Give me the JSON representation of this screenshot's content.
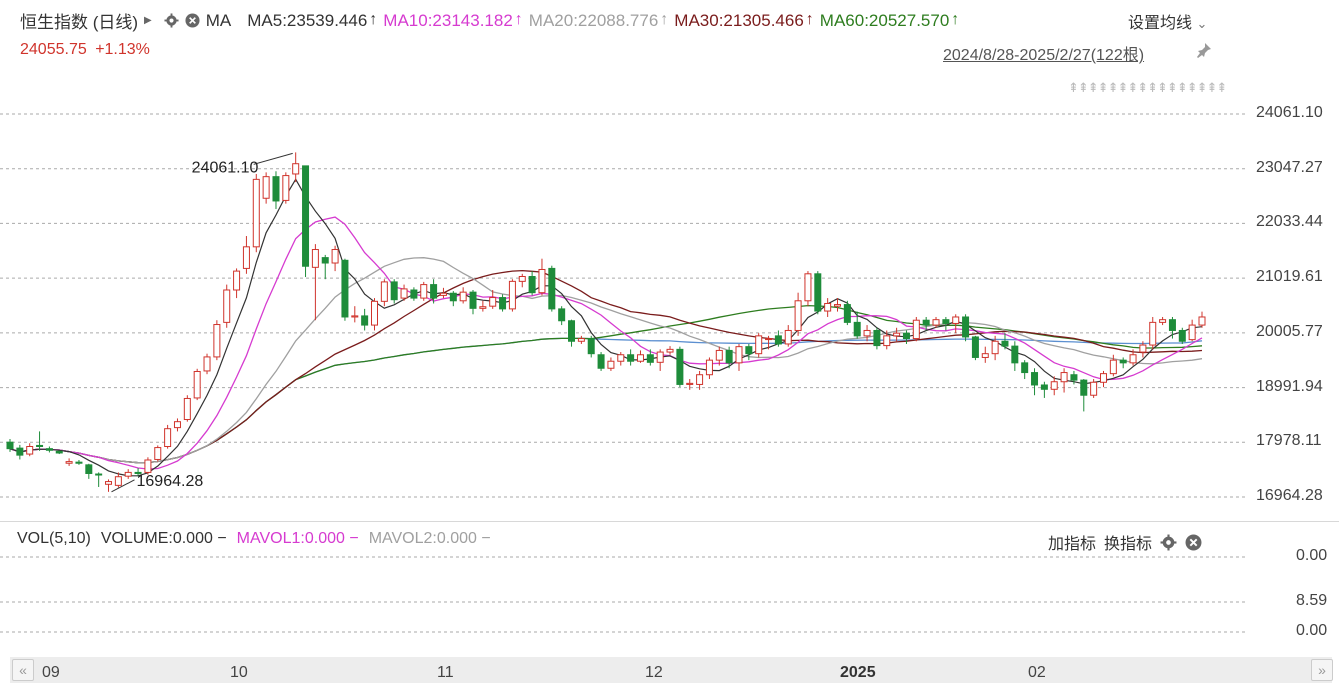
{
  "header": {
    "title": "恒生指数 (日线)",
    "ma_label": "MA",
    "ma_values": [
      {
        "label": "MA5:23539.446",
        "color": "#333333"
      },
      {
        "label": "MA10:23143.182",
        "color": "#d63bd0"
      },
      {
        "label": "MA20:22088.776",
        "color": "#a0a0a0"
      },
      {
        "label": "MA30:21305.466",
        "color": "#7a1c1c"
      },
      {
        "label": "MA60:20527.570",
        "color": "#2e7d1f"
      }
    ],
    "arrow": "↑",
    "settings_label": "设置均线",
    "settings_chevron": "⌄"
  },
  "price": {
    "value": "24055.75",
    "change": "+1.13%"
  },
  "range_label": "2024/8/28-2025/2/27(122根)",
  "pin_icon": "pin-icon",
  "marker_arrows": "⇞⇞⇞⇞⇞⇞⇞⇞⇞⇞⇞⇞⇞⇞⇞⇞",
  "y_ticks": [
    "24061.10",
    "23047.27",
    "22033.44",
    "21019.61",
    "20005.77",
    "18991.94",
    "17978.11",
    "16964.28"
  ],
  "annotations": {
    "high": "24061.10",
    "low": "16964.28"
  },
  "volume": {
    "label": "VOL(5,10)",
    "volume": "VOLUME:0.000",
    "mavol1": "MAVOL1:0.000",
    "mavol2": "MAVOL2:0.000",
    "dash": "−",
    "add_indicator": "加指标",
    "switch_indicator": "换指标",
    "y_ticks": [
      "0.00",
      "8.59",
      "0.00"
    ]
  },
  "x_labels": [
    "09",
    "10",
    "11",
    "12",
    "2025",
    "02"
  ],
  "colors": {
    "up": "#d0342c",
    "down": "#1e8c3a",
    "ma5": "#333333",
    "ma10": "#d63bd0",
    "ma20": "#a0a0a0",
    "ma30": "#7a1c1c",
    "ma60": "#2e7d1f",
    "ma120": "#5b8fd0"
  },
  "chart_data": {
    "type": "candlestick",
    "ylim": [
      16964.28,
      24061.1
    ],
    "candles": [
      [
        17980,
        17860,
        18040,
        17800
      ],
      [
        17870,
        17740,
        17930,
        17660
      ],
      [
        17760,
        17900,
        17960,
        17720
      ],
      [
        17920,
        17900,
        18180,
        17820
      ],
      [
        17860,
        17830,
        17900,
        17790
      ],
      [
        17810,
        17780,
        17820,
        17760
      ],
      [
        17590,
        17620,
        17680,
        17540
      ],
      [
        17610,
        17590,
        17650,
        17560
      ],
      [
        17560,
        17400,
        17580,
        17300
      ],
      [
        17390,
        17380,
        17420,
        17150
      ],
      [
        17200,
        17250,
        17290,
        17060
      ],
      [
        17180,
        17340,
        17420,
        17140
      ],
      [
        17350,
        17420,
        17480,
        17300
      ],
      [
        17420,
        17400,
        17500,
        17360
      ],
      [
        17420,
        17650,
        17700,
        17380
      ],
      [
        17660,
        17880,
        17920,
        17620
      ],
      [
        17900,
        18230,
        18300,
        17860
      ],
      [
        18250,
        18360,
        18420,
        18180
      ],
      [
        18400,
        18790,
        18850,
        18360
      ],
      [
        18800,
        19290,
        19340,
        18760
      ],
      [
        19300,
        19560,
        19620,
        19240
      ],
      [
        19560,
        20160,
        20240,
        19500
      ],
      [
        20200,
        20800,
        20900,
        20100
      ],
      [
        20800,
        21150,
        21200,
        20650
      ],
      [
        21200,
        21600,
        21800,
        21100
      ],
      [
        21600,
        22850,
        22950,
        21500
      ],
      [
        22500,
        22900,
        22980,
        22400
      ],
      [
        22900,
        22450,
        23000,
        22300
      ],
      [
        22460,
        22920,
        22980,
        22400
      ],
      [
        22950,
        23140,
        23350,
        22800
      ],
      [
        23100,
        21240,
        23100,
        21040
      ],
      [
        21220,
        21550,
        21650,
        20240
      ],
      [
        21400,
        21300,
        21450,
        21000
      ],
      [
        21300,
        21550,
        21620,
        21150
      ],
      [
        21350,
        20300,
        21380,
        20230
      ],
      [
        20300,
        20320,
        20500,
        20200
      ],
      [
        20320,
        20150,
        20450,
        20050
      ],
      [
        20150,
        20590,
        20650,
        20050
      ],
      [
        20590,
        20950,
        21000,
        20500
      ],
      [
        20950,
        20620,
        21000,
        20550
      ],
      [
        20650,
        20820,
        20900,
        20600
      ],
      [
        20800,
        20650,
        20850,
        20600
      ],
      [
        20650,
        20900,
        20950,
        20600
      ],
      [
        20900,
        20650,
        21000,
        20550
      ],
      [
        20700,
        20740,
        20840,
        20650
      ],
      [
        20740,
        20600,
        20780,
        20500
      ],
      [
        20600,
        20760,
        20850,
        20550
      ],
      [
        20760,
        20460,
        20800,
        20350
      ],
      [
        20460,
        20490,
        20600,
        20400
      ],
      [
        20500,
        20660,
        20800,
        20450
      ],
      [
        20660,
        20450,
        20720,
        20400
      ],
      [
        20450,
        20960,
        21000,
        20400
      ],
      [
        20960,
        21050,
        21100,
        20850
      ],
      [
        21050,
        20750,
        21150,
        20700
      ],
      [
        20750,
        21180,
        21380,
        20700
      ],
      [
        21200,
        20450,
        21250,
        20400
      ],
      [
        20450,
        20230,
        20500,
        20150
      ],
      [
        20230,
        19850,
        20250,
        19750
      ],
      [
        19850,
        19900,
        19950,
        19800
      ],
      [
        19900,
        19620,
        19950,
        19550
      ],
      [
        19600,
        19350,
        19650,
        19300
      ],
      [
        19350,
        19480,
        19550,
        19300
      ],
      [
        19480,
        19600,
        19650,
        19400
      ],
      [
        19600,
        19480,
        19700,
        19400
      ],
      [
        19480,
        19600,
        19680,
        19450
      ],
      [
        19600,
        19460,
        19700,
        19400
      ],
      [
        19460,
        19650,
        19700,
        19300
      ],
      [
        19650,
        19700,
        19760,
        19600
      ],
      [
        19700,
        19050,
        19750,
        19000
      ],
      [
        19050,
        19070,
        19150,
        18950
      ],
      [
        19050,
        19230,
        19300,
        18950
      ],
      [
        19230,
        19500,
        19550,
        19150
      ],
      [
        19500,
        19680,
        19750,
        19400
      ],
      [
        19680,
        19450,
        19750,
        19350
      ],
      [
        19450,
        19750,
        19800,
        19300
      ],
      [
        19750,
        19620,
        19800,
        19500
      ],
      [
        19620,
        19950,
        20000,
        19550
      ],
      [
        19900,
        19900,
        19950,
        19700
      ],
      [
        19950,
        19800,
        20050,
        19750
      ],
      [
        19800,
        20050,
        20150,
        19750
      ],
      [
        20050,
        20600,
        20750,
        19950
      ],
      [
        20600,
        21100,
        21150,
        20500
      ],
      [
        21100,
        20410,
        21150,
        20350
      ],
      [
        20410,
        20550,
        20650,
        20300
      ],
      [
        20500,
        20530,
        20650,
        20400
      ],
      [
        20530,
        20200,
        20600,
        20150
      ],
      [
        20200,
        19950,
        20400,
        19900
      ],
      [
        19950,
        20050,
        20150,
        19850
      ],
      [
        20050,
        19770,
        20100,
        19700
      ],
      [
        19770,
        19950,
        20050,
        19700
      ],
      [
        19950,
        20000,
        20100,
        19850
      ],
      [
        20000,
        19900,
        20050,
        19800
      ],
      [
        19900,
        20240,
        20300,
        19850
      ],
      [
        20240,
        20150,
        20300,
        20050
      ],
      [
        20150,
        20250,
        20300,
        20100
      ],
      [
        20250,
        20180,
        20300,
        20050
      ],
      [
        20180,
        20300,
        20350,
        20000
      ],
      [
        20300,
        19930,
        20350,
        19850
      ],
      [
        19930,
        19550,
        19950,
        19500
      ],
      [
        19550,
        19620,
        19750,
        19450
      ],
      [
        19620,
        19850,
        19950,
        19500
      ],
      [
        19850,
        19760,
        20000,
        19700
      ],
      [
        19760,
        19450,
        19850,
        19300
      ],
      [
        19450,
        19270,
        19500,
        19150
      ],
      [
        19270,
        19040,
        19350,
        18850
      ],
      [
        19040,
        18960,
        19100,
        18800
      ],
      [
        18960,
        19100,
        19200,
        18850
      ],
      [
        19100,
        19270,
        19350,
        18900
      ],
      [
        19230,
        19130,
        19300,
        19050
      ],
      [
        19130,
        18850,
        19150,
        18550
      ],
      [
        18850,
        19090,
        19150,
        18800
      ],
      [
        19090,
        19250,
        19300,
        19000
      ],
      [
        19250,
        19500,
        19600,
        19200
      ],
      [
        19500,
        19450,
        19550,
        19350
      ],
      [
        19450,
        19600,
        19700,
        19400
      ],
      [
        19650,
        19780,
        19850,
        19550
      ],
      [
        19780,
        20200,
        20300,
        19700
      ],
      [
        20200,
        20250,
        20300,
        20150
      ],
      [
        20250,
        20050,
        20300,
        19900
      ],
      [
        20050,
        19850,
        20100,
        19800
      ],
      [
        19880,
        20150,
        20250,
        19850
      ],
      [
        20150,
        20300,
        20400,
        20100
      ]
    ]
  }
}
